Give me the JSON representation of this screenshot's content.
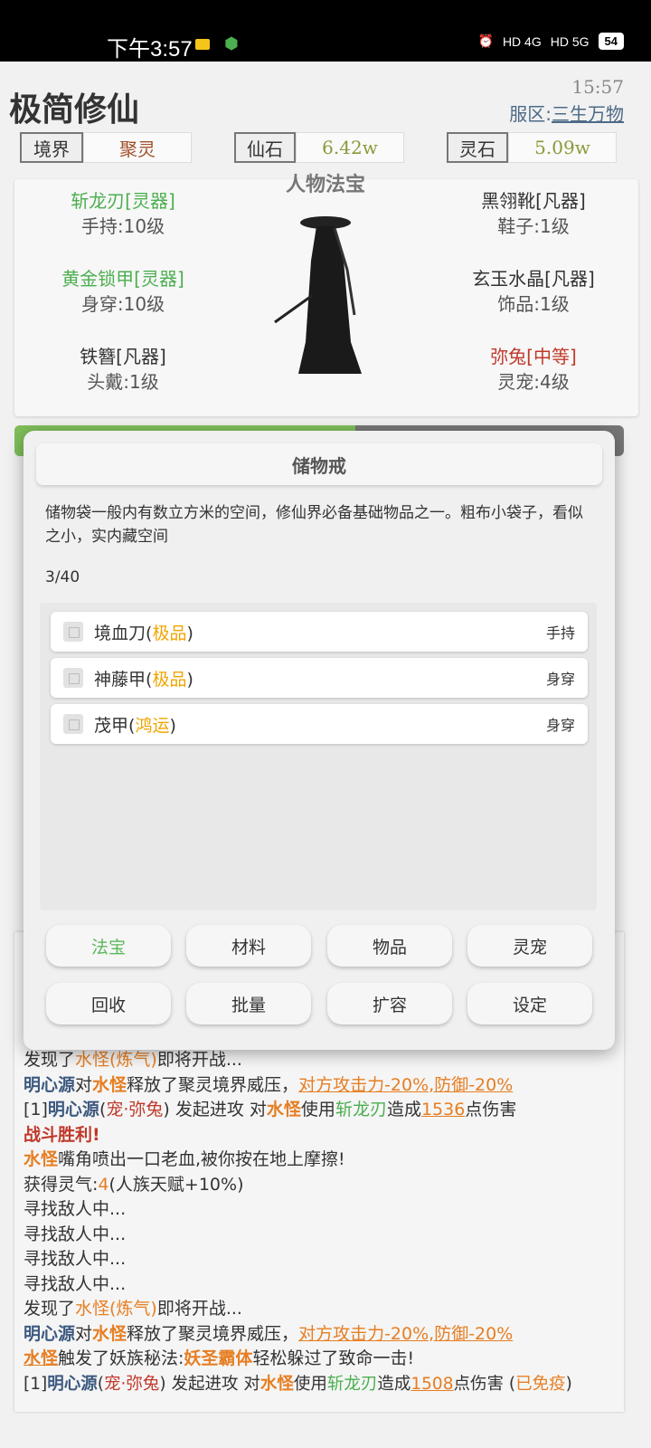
{
  "status": {
    "time": "下午3:57",
    "signal1": "HD 4G",
    "signal2": "HD 5G",
    "battery": "54"
  },
  "header": {
    "title": "极简修仙",
    "clock": "15:57",
    "server_prefix": "服区:",
    "server_name": "三生万物"
  },
  "stats": [
    {
      "label": "境界",
      "value": "聚灵",
      "color": "#a0522d"
    },
    {
      "label": "仙石",
      "value": "6.42w",
      "color": "#8a9a3a"
    },
    {
      "label": "灵石",
      "value": "5.09w",
      "color": "#8a9a3a"
    }
  ],
  "equip": {
    "title": "人物法宝",
    "left": [
      {
        "name": "斩龙刃[灵器]",
        "slot": "手持:10级",
        "tone": "green"
      },
      {
        "name": "黄金锁甲[灵器]",
        "slot": "身穿:10级",
        "tone": "green"
      },
      {
        "name": "铁簪[凡器]",
        "slot": "头戴:1级",
        "tone": "dark"
      }
    ],
    "right": [
      {
        "name": "黑翎靴[凡器]",
        "slot": "鞋子:1级",
        "tone": "dark"
      },
      {
        "name": "玄玉水晶[凡器]",
        "slot": "饰品:1级",
        "tone": "dark"
      },
      {
        "name": "弥兔[中等]",
        "slot": "灵宠:4级",
        "tone": "red"
      }
    ]
  },
  "modal": {
    "title": "储物戒",
    "description": "储物袋一般内有数立方米的空间，修仙界必备基础物品之一。粗布小袋子，看似之小，实内藏空间",
    "count": "3/40",
    "items": [
      {
        "name": "境血刀",
        "quality": "极品",
        "slot": "手持"
      },
      {
        "name": "神藤甲",
        "quality": "极品",
        "slot": "身穿"
      },
      {
        "name": "茂甲",
        "quality": "鸿运",
        "slot": "身穿"
      }
    ],
    "buttons_row1": [
      "法宝",
      "材料",
      "物品",
      "灵宠"
    ],
    "buttons_row2": [
      "回收",
      "批量",
      "扩容",
      "设定"
    ]
  },
  "log": {
    "line1": [
      "发现了",
      "水怪(炼气)",
      "即将开战..."
    ],
    "line2": [
      "明心源",
      "对",
      "水怪",
      "释放了聚灵境界威压，",
      "对方攻击力-20%,防御-20%"
    ],
    "line3": [
      "[1]",
      "明心源",
      "(",
      "宠·弥兔",
      ") 发起进攻 对",
      "水怪",
      "使用",
      "斩龙刃",
      "造成",
      "1536",
      "点伤害"
    ],
    "line4": "战斗胜利!",
    "line5": [
      "水怪",
      "嘴角喷出一口老血,被你按在地上摩擦!"
    ],
    "line6": [
      "获得灵气:",
      "4",
      "(人族天赋+10%)"
    ],
    "seek": "寻找敌人中...",
    "line11": [
      "发现了",
      "水怪(炼气)",
      "即将开战..."
    ],
    "line12": [
      "明心源",
      "对",
      "水怪",
      "释放了聚灵境界威压，",
      "对方攻击力-20%,防御-20%"
    ],
    "line13": [
      "水怪",
      "触发了妖族秘法:",
      "妖圣霸体",
      "轻松躲过了致命一击!"
    ],
    "line14": [
      "[1]",
      "明心源",
      "(",
      "宠·弥兔",
      ") 发起进攻 对",
      "水怪",
      "使用",
      "斩龙刃",
      "造成",
      "1508",
      "点伤害 (",
      "已免疫",
      ")"
    ]
  },
  "progress": {
    "fill": 0.56
  }
}
